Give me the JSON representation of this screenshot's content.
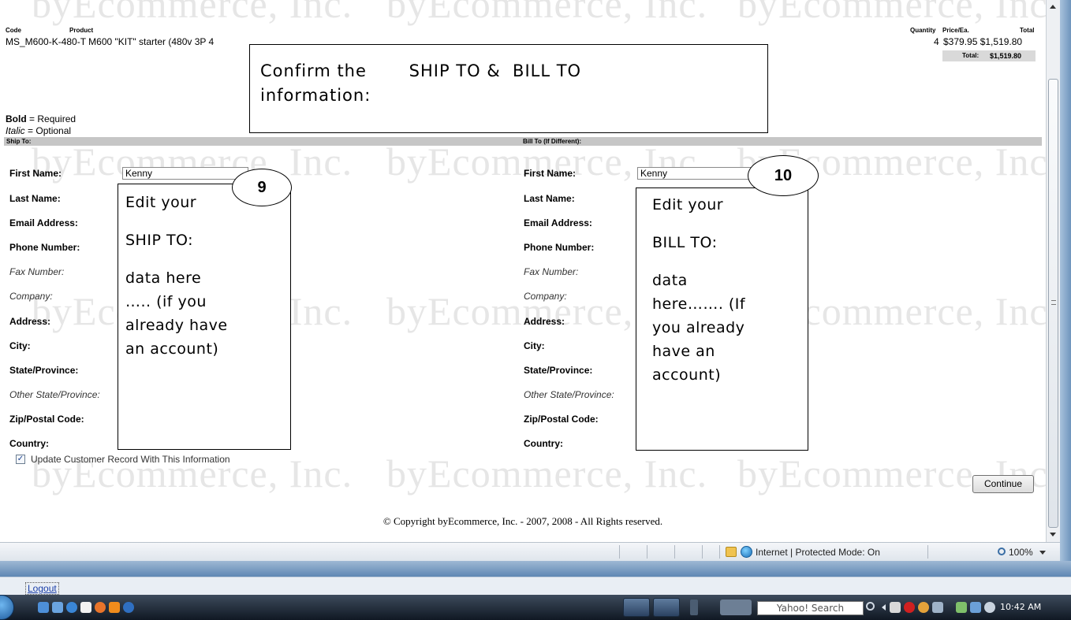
{
  "order": {
    "headers": {
      "code": "Code",
      "product": "Product",
      "quantity": "Quantity",
      "price_ea": "Price/Ea.",
      "total": "Total"
    },
    "items": [
      {
        "code_product": "MS_M600-K-480-T M600 \"KIT\" starter (480v 3P 4",
        "quantity": "4",
        "price_total": "$379.95 $1,519.80"
      }
    ],
    "total_label": "Total:",
    "total_value": "$1,519.80"
  },
  "legend": {
    "bold_word": "Bold",
    "bold_text": " = Required",
    "italic_word": "Italic",
    "italic_text": " = Optional"
  },
  "ship_to": {
    "header": "Ship To:",
    "fields": {
      "first_name": "First Name:",
      "last_name": "Last Name:",
      "email": "Email Address:",
      "phone": "Phone Number:",
      "fax": "Fax Number:",
      "company": "Company:",
      "address": "Address:",
      "city": "City:",
      "state": "State/Province:",
      "other_state": "Other State/Province:",
      "zip": "Zip/Postal Code:",
      "country": "Country:"
    },
    "first_name_value": "Kenny"
  },
  "bill_to": {
    "header": "Bill To (If Different):",
    "fields": {
      "first_name": "First Name:",
      "last_name": "Last Name:",
      "email": "Email Address:",
      "phone": "Phone Number:",
      "fax": "Fax Number:",
      "company": "Company:",
      "address": "Address:",
      "city": "City:",
      "state": "State/Province:",
      "other_state": "Other State/Province:",
      "zip": "Zip/Postal Code:",
      "country": "Country:"
    },
    "first_name_value": "Kenny"
  },
  "update_checkbox": {
    "label": "Update Customer Record With This Information",
    "checked": true
  },
  "continue_button": "Continue",
  "copyright": "© Copyright byEcommerce, Inc. - 2007, 2008 - All Rights reserved.",
  "watermark": "byEcommerce, Inc.",
  "callouts": {
    "main": {
      "line1": "Confirm the       SHIP TO &  BILL TO",
      "line2": "information:"
    },
    "ship": {
      "number": "9",
      "line1": "Edit your",
      "line2": "SHIP TO:",
      "line3": "data here",
      "line4": "….. (if you",
      "line5": "already have",
      "line6": "an account)"
    },
    "bill": {
      "number": "10",
      "line1": "Edit your",
      "line2": "BILL TO:",
      "line3": "data",
      "line4": "here……. (If",
      "line5": "you already",
      "line6": "have an",
      "line7": "account)"
    }
  },
  "statusbar": {
    "zone": "Internet | Protected Mode: On",
    "zoom": "100%"
  },
  "linkbar": {
    "logout": "Logout"
  },
  "taskbar": {
    "search_placeholder": "Yahoo! Search",
    "clock": "10:42 AM"
  },
  "colors": {
    "section_bar": "#c6c6c6",
    "watermark": "#e6e6e6",
    "taskbar": "#1c2634"
  }
}
